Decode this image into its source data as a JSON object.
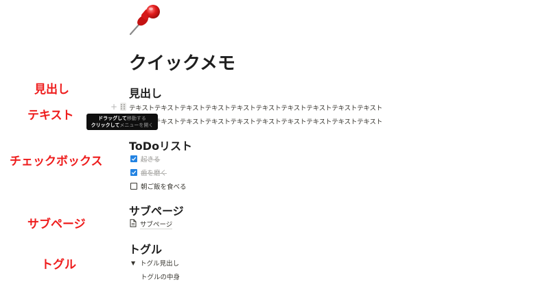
{
  "annotations": {
    "heading": "見出し",
    "text": "テキスト",
    "checkbox": "チェックボックス",
    "subpage": "サブページ",
    "toggle": "トグル"
  },
  "page": {
    "icon": "pushpin-icon",
    "title": "クイックメモ"
  },
  "sections": {
    "heading": "見出し",
    "text_lines": [
      "テキストテキストテキストテキストテキストテキストテキストテキストテキストテキスト",
      "テキストテキストテキストテキストテキストテキストテキストテキストテキストテキスト"
    ],
    "tooltip": {
      "line1_bold": "ドラッグして",
      "line1_rest": "移動する",
      "line2_bold": "クリックして",
      "line2_rest": "メニューを開く"
    },
    "todo": {
      "heading": "ToDoリスト",
      "items": [
        {
          "label": "起きる",
          "checked": true
        },
        {
          "label": "歯を磨く",
          "checked": true
        },
        {
          "label": "朝ご飯を食べる",
          "checked": false
        }
      ]
    },
    "subpage": {
      "heading": "サブページ",
      "link_label": "サブページ"
    },
    "toggle": {
      "heading": "トグル",
      "title": "トグル見出し",
      "body": "トグルの中身"
    }
  },
  "colors": {
    "annotation": "#ee1c1c",
    "checkbox_checked": "#2383e2",
    "tooltip_bg": "#0f0f0f"
  }
}
